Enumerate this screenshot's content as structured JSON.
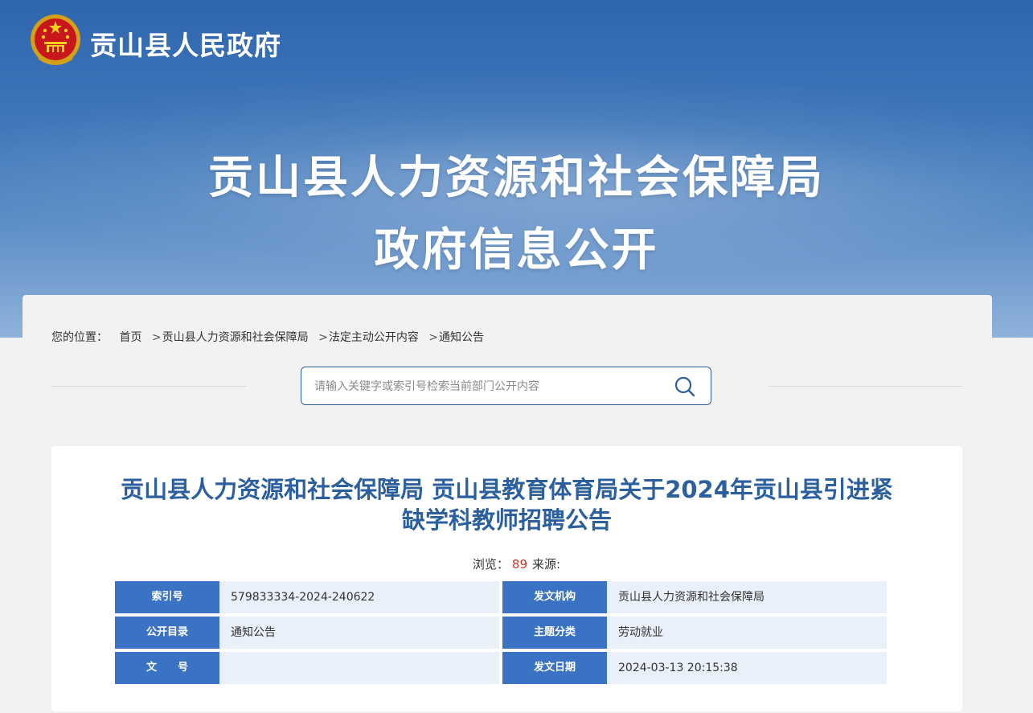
{
  "header": {
    "site_title": "贡山县人民政府",
    "hero_line1": "贡山县人力资源和社会保障局",
    "hero_line2": "政府信息公开"
  },
  "breadcrumb": {
    "prefix": "您的位置：",
    "items": [
      "首页",
      "贡山县人力资源和社会保障局",
      "法定主动公开内容",
      "通知公告"
    ],
    "separator": ">"
  },
  "search": {
    "placeholder": "请输入关键字或索引号检索当前部门公开内容",
    "value": ""
  },
  "article": {
    "title_line1": "贡山县人力资源和社会保障局 贡山县教育体育局关于2024年贡山县引进紧",
    "title_line2": "缺学科教师招聘公告",
    "views_label": "浏览：",
    "views": "89",
    "source_label": "来源:"
  },
  "info": {
    "index_no_label": "索引号",
    "index_no": "579833334-2024-240622",
    "issuer_label": "发文机构",
    "issuer": "贡山县人力资源和社会保障局",
    "catalog_label": "公开目录",
    "catalog": "通知公告",
    "topic_label": "主题分类",
    "topic": "劳动就业",
    "doc_no_label": "文　　号",
    "doc_no": "",
    "date_label": "发文日期",
    "date": "2024-03-13 20:15:38"
  },
  "colors": {
    "banner_top": "#2f65ad",
    "title_blue": "#2c5f9e",
    "label_blue": "#3a73c4",
    "value_bg": "#eaf0f9",
    "views_red": "#c0392b"
  }
}
